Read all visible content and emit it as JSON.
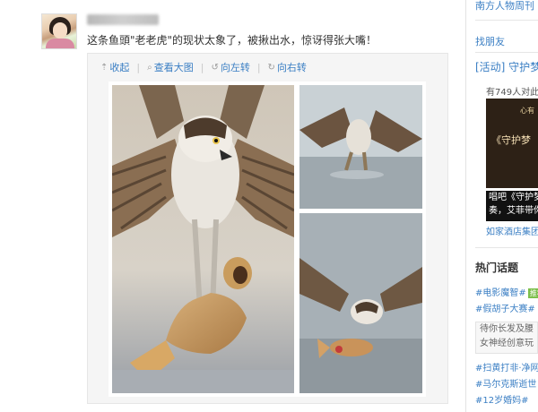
{
  "post": {
    "text": "这条鱼頭\"老老虎\"的现状太象了，被揪出水，惊讶得张大嘴！",
    "toolbar": {
      "collapse": "收起",
      "view_large": "查看大图",
      "rotate_left": "向左转",
      "rotate_right": "向右转"
    }
  },
  "sidebar": {
    "top_link": "南方人物周刊",
    "find_friends": "找朋友",
    "activity_title": "[活动] 守护梦",
    "participants": "有749人对此",
    "ad_title": "《守护梦",
    "ad_corner": "心有",
    "ad_caption": [
      "唱吧《守护梦",
      "奏，艾菲带你"
    ],
    "sponsor_link": "如家酒店集团",
    "hot_topics_title": "热门话题",
    "topics_top": [
      "#电影魔智#",
      "#假胡子大赛#"
    ],
    "hot_label": "推荐",
    "topic_box_lines": [
      "待你长发及腰",
      "女神经创意玩"
    ],
    "topics_bottom": [
      "#扫黄打非·净网",
      "#马尔克斯逝世",
      "#12岁婚妈#"
    ]
  },
  "colors": {
    "link": "#3b7fc4",
    "hot_tag": "#7cbf4c"
  },
  "icons": [
    "collapse-icon",
    "view-large-icon",
    "rotate-left-icon",
    "rotate-right-icon"
  ]
}
